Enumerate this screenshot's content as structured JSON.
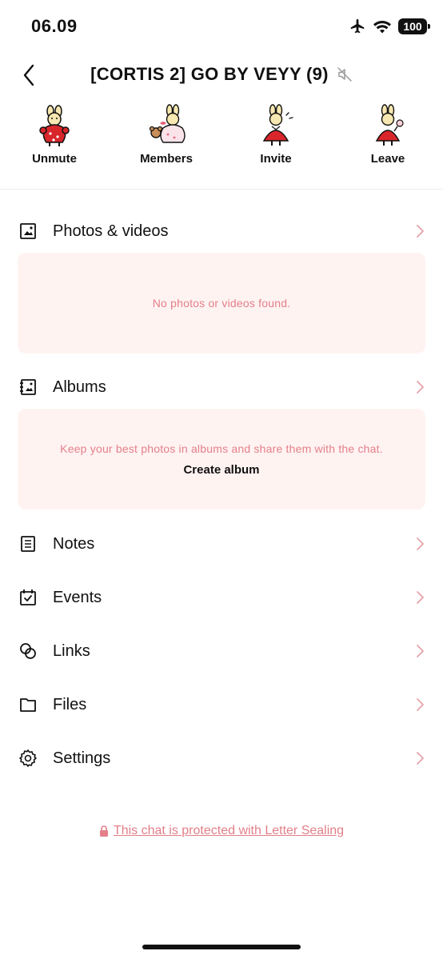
{
  "status_bar": {
    "time": "06.09",
    "battery": "100"
  },
  "header": {
    "title": "[CORTIS 2] GO BY VEYY (9)"
  },
  "actions": [
    {
      "label": "Unmute"
    },
    {
      "label": "Members"
    },
    {
      "label": "Invite"
    },
    {
      "label": "Leave"
    }
  ],
  "sections": {
    "photos": {
      "label": "Photos & videos",
      "empty": "No photos or videos found."
    },
    "albums": {
      "label": "Albums",
      "empty": "Keep your best photos in albums and share them with the chat.",
      "create": "Create album"
    },
    "notes": {
      "label": "Notes"
    },
    "events": {
      "label": "Events"
    },
    "links": {
      "label": "Links"
    },
    "files": {
      "label": "Files"
    },
    "settings": {
      "label": "Settings"
    }
  },
  "footer": {
    "letter_sealing": "This chat is protected with Letter Sealing"
  },
  "colors": {
    "accent_pink": "#e37f89",
    "card_bg": "#fff3f2",
    "chevron": "#e6a3aa",
    "sticker_red": "#d8262b"
  }
}
